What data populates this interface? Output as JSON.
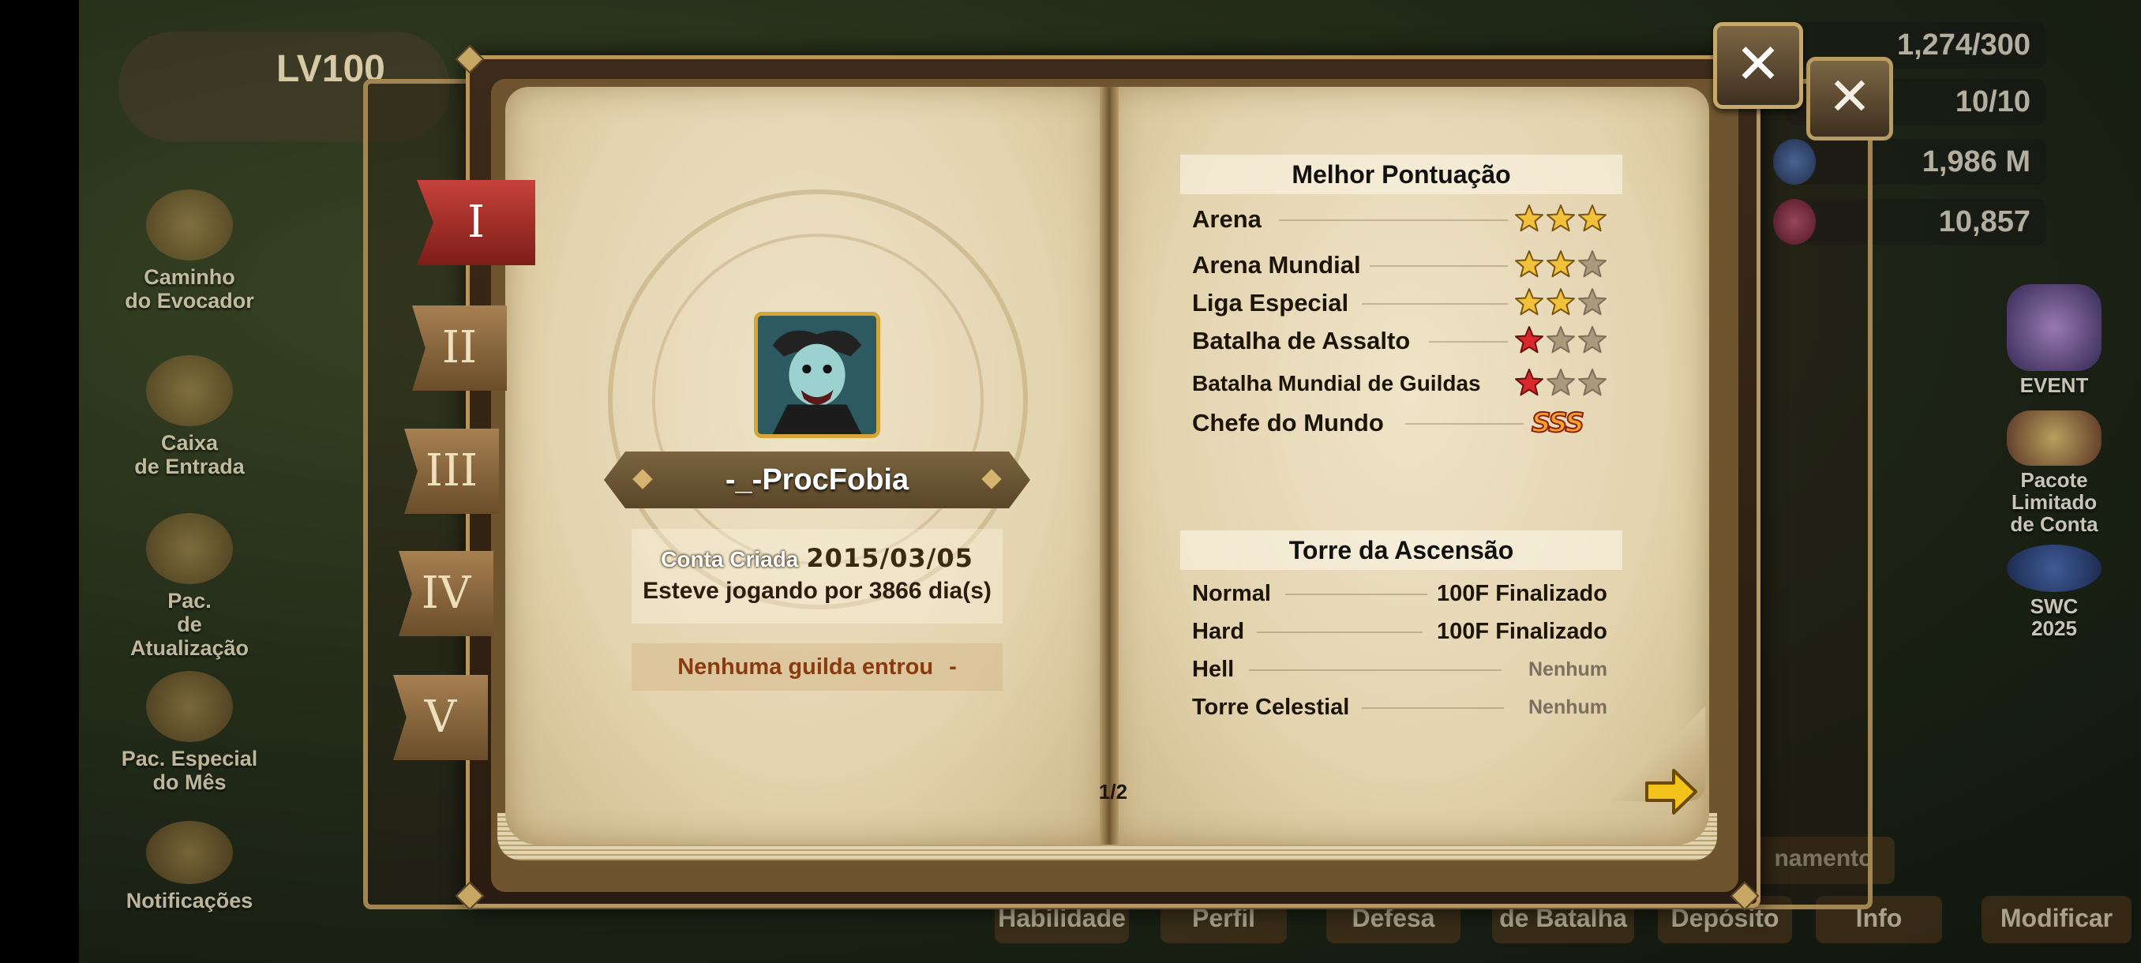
{
  "background": {
    "level_badge": "LV100",
    "left_menu": [
      {
        "label": "Caminho\ndo Evocador"
      },
      {
        "label": "Caixa\nde Entrada"
      },
      {
        "label": "Pac.\nde Atualização"
      },
      {
        "label": "Pac. Especial\ndo Mês"
      },
      {
        "label": "Notificações"
      }
    ],
    "resources": [
      {
        "value": "1,274/300",
        "color": "#d6b44a"
      },
      {
        "value": "10/10",
        "color": "#c8cfd8"
      },
      {
        "value": "1,986 M",
        "color": "#4a7fd8"
      },
      {
        "value": "10,857",
        "color": "#c8386a"
      }
    ],
    "right_menu": [
      {
        "label": "EVENT"
      },
      {
        "label": "Pacote Limitado\nde Conta"
      },
      {
        "label": "SWC\n2025"
      }
    ],
    "bottom_buttons": [
      "Habilidade",
      "Perfil",
      "Defesa",
      "de Batalha",
      "Depósito",
      "Info",
      "Modificar"
    ],
    "side_button": "namento"
  },
  "book": {
    "tabs": [
      "I",
      "II",
      "III",
      "IV",
      "V"
    ],
    "active_tab": 0,
    "profile": {
      "name": "-_-ProcFobia",
      "created_label": "Conta Criada",
      "created_date": "2015/03/05",
      "played_text": "Esteve jogando por 3866 dia(s)",
      "guild_text": "Nenhuma guilda entrou",
      "guild_value": "-"
    },
    "best_score": {
      "title": "Melhor Pontuação",
      "rows": [
        {
          "label": "Arena",
          "stars": 3,
          "star_color": "gold"
        },
        {
          "label": "Arena Mundial",
          "stars": 2,
          "star_color": "gold"
        },
        {
          "label": "Liga Especial",
          "stars": 2,
          "star_color": "gold"
        },
        {
          "label": "Batalha de Assalto",
          "stars": 1,
          "star_color": "red"
        },
        {
          "label": "Batalha Mundial de Guildas",
          "stars": 1,
          "star_color": "red"
        },
        {
          "label": "Chefe do Mundo",
          "rank": "SSS"
        }
      ]
    },
    "tower": {
      "title": "Torre da Ascensão",
      "rows": [
        {
          "label": "Normal",
          "value": "100F Finalizado"
        },
        {
          "label": "Hard",
          "value": "100F Finalizado"
        },
        {
          "label": "Hell",
          "value": "Nenhum"
        },
        {
          "label": "Torre Celestial",
          "value": "Nenhum"
        }
      ]
    },
    "pager": "1/2"
  }
}
